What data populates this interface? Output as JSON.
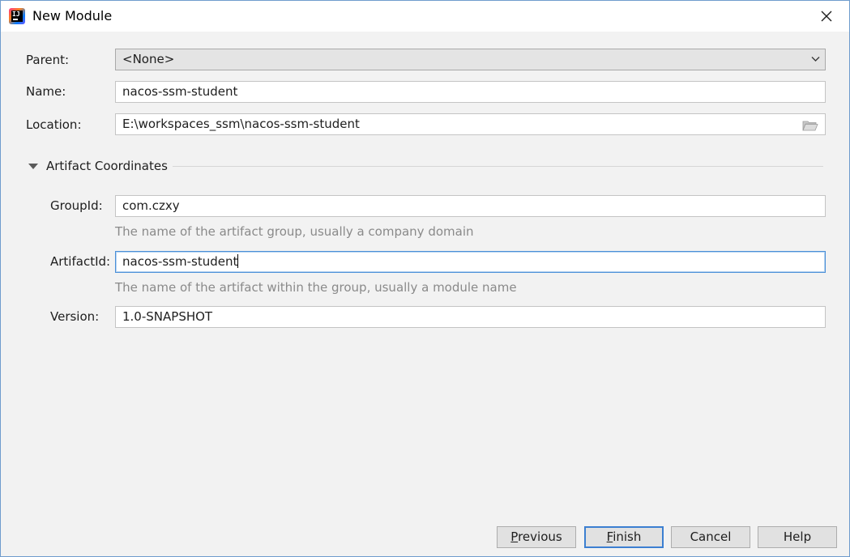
{
  "window": {
    "title": "New Module"
  },
  "form": {
    "parent": {
      "label": "Parent:",
      "value": "<None>"
    },
    "name": {
      "label": "Name:",
      "value": "nacos-ssm-student"
    },
    "location": {
      "label": "Location:",
      "value": "E:\\workspaces_ssm\\nacos-ssm-student"
    }
  },
  "artifact": {
    "section_title": "Artifact Coordinates",
    "group_id": {
      "label": "GroupId:",
      "value": "com.czxy",
      "hint": "The name of the artifact group, usually a company domain"
    },
    "artifact_id": {
      "label": "ArtifactId:",
      "value": "nacos-ssm-student",
      "hint": "The name of the artifact within the group, usually a module name"
    },
    "version": {
      "label": "Version:",
      "value": "1.0-SNAPSHOT"
    }
  },
  "buttons": {
    "previous_mnemonic": "P",
    "previous_rest": "revious",
    "finish_mnemonic": "F",
    "finish_rest": "inish",
    "cancel": "Cancel",
    "help": "Help"
  }
}
